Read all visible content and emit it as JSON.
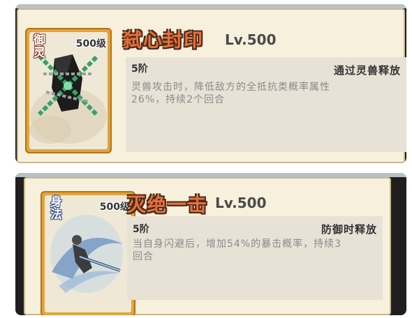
{
  "skills": [
    {
      "card_tag": "御灵",
      "card_level": "500级",
      "card_art": "chained-seal-art",
      "name": "弑心封印",
      "level": "Lv.500",
      "stage": "5阶",
      "trigger": "通过灵兽释放",
      "description_line1": "灵兽攻击时，降低敌方的全抵抗类概率属性",
      "description_line2": "26%，持续2个回合"
    },
    {
      "card_tag": "身法",
      "card_level": "500级",
      "card_art": "swordsman-strike-art",
      "name": "灭绝一击",
      "level": "Lv.500",
      "stage": "5阶",
      "trigger": "防御时释放",
      "description_line1": "当自身闪避后，增加54%的暴击概率，持续3",
      "description_line2": "回合"
    }
  ]
}
